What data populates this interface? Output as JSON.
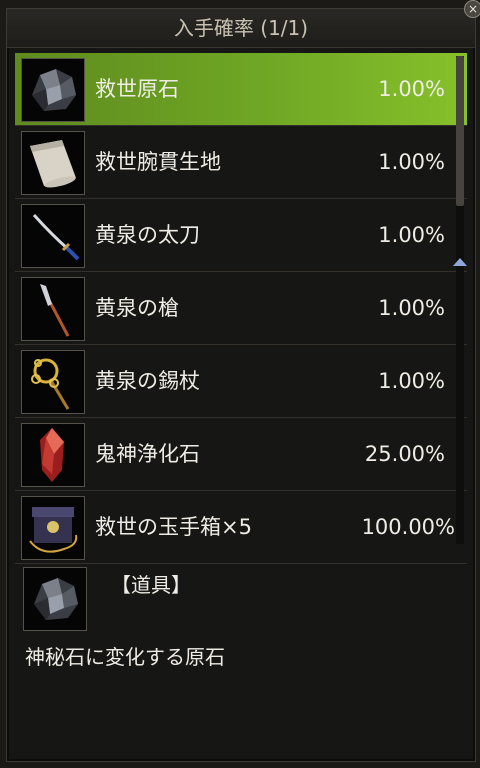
{
  "window": {
    "title": "入手確率 (1/1)",
    "close_label": "×"
  },
  "items": [
    {
      "name": "救世原石",
      "rate": "1.00%",
      "icon": "ore-stone-icon",
      "selected": true
    },
    {
      "name": "救世腕貫生地",
      "rate": "1.00%",
      "icon": "cloth-roll-icon",
      "selected": false
    },
    {
      "name": "黄泉の太刀",
      "rate": "1.00%",
      "icon": "sword-icon",
      "selected": false
    },
    {
      "name": "黄泉の槍",
      "rate": "1.00%",
      "icon": "spear-icon",
      "selected": false
    },
    {
      "name": "黄泉の錫杖",
      "rate": "1.00%",
      "icon": "staff-icon",
      "selected": false
    },
    {
      "name": "鬼神浄化石",
      "rate": "25.00%",
      "icon": "red-crystal-icon",
      "selected": false
    },
    {
      "name": "救世の玉手箱×5",
      "rate": "100.00%",
      "icon": "treasure-box-icon",
      "selected": false
    }
  ],
  "detail": {
    "category": "【道具】",
    "description": "神秘石に変化する原石",
    "icon": "ore-stone-icon"
  },
  "colors": {
    "selected_row": "#6fa725",
    "scroll_arrow": "#8ea6d8"
  }
}
